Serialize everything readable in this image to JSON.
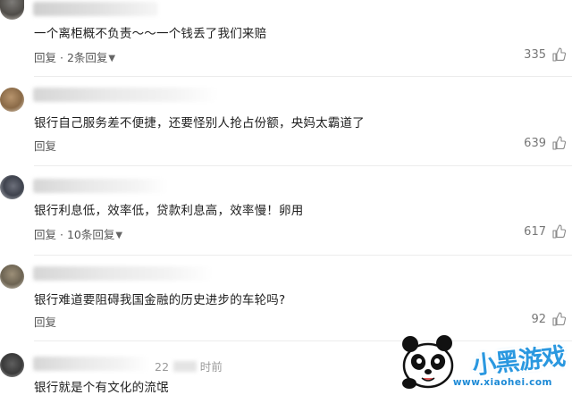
{
  "comments": [
    {
      "text": "一个离柜概不负责～～一个钱丢了我们来赔",
      "reply_label": "回复",
      "replies_label": "2条回复",
      "likes": "335"
    },
    {
      "text": "银行自己服务差不便捷，还要怪别人抢占份额，央妈太霸道了",
      "likes": "639"
    },
    {
      "text": "银行利息低，效率低，贷款利息高，效率慢！卵用",
      "reply_label": "回复",
      "replies_label": "10条回复",
      "likes": "617"
    },
    {
      "text": "银行难道要阻碍我国金融的历史进步的车轮吗?",
      "reply_label": "回复",
      "likes": "92"
    },
    {
      "meta_text": "22",
      "time_label": "时前",
      "text": "银行就是个有文化的流氓"
    }
  ],
  "first_comment_name_fragment": "时前",
  "reply_single": "回复",
  "watermark": {
    "title": "小黑游戏",
    "url": "www.xiaohei.com",
    "accent_color": "#2a98e0"
  },
  "icons": {
    "like": "thumbs-up-icon",
    "expand": "chevron-down-icon"
  }
}
